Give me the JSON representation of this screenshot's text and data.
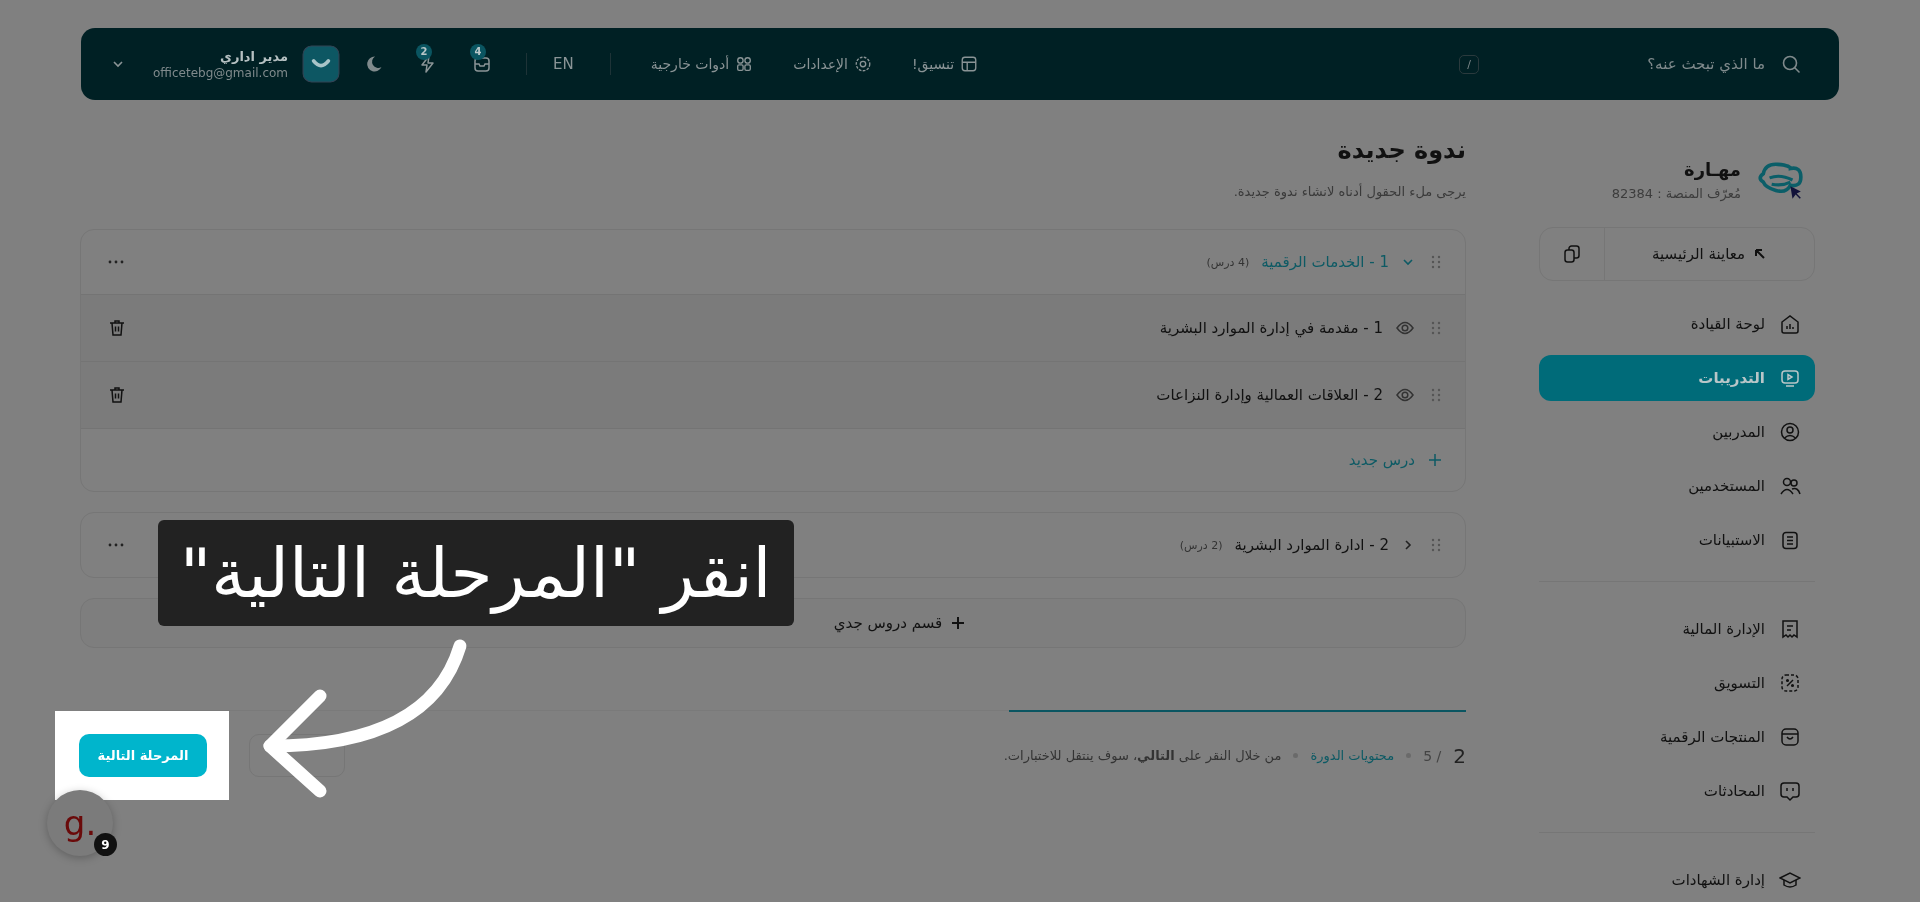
{
  "topbar": {
    "search": {
      "placeholder": "ما الذي تبحث عنه؟",
      "shortcut": "/"
    },
    "links": [
      "تنسيق!",
      "الإعدادات",
      "أدوات خارجية"
    ],
    "language": "EN",
    "notifications": [
      {
        "count": "4"
      },
      {
        "count": "2"
      }
    ],
    "user": {
      "name": "مدير اداري",
      "email": "officetebg@gmail.com"
    }
  },
  "sidebar": {
    "brand": {
      "name": "مهـارة",
      "platform_id": "مُعرّف المنصة : 82384"
    },
    "preview": "معاينة الرئيسية",
    "groups": [
      [
        {
          "label": "لوحة القيادة",
          "selected": false
        },
        {
          "label": "التدريبات",
          "selected": true
        },
        {
          "label": "المدربين",
          "selected": false
        },
        {
          "label": "المستخدمين",
          "selected": false
        },
        {
          "label": "الاستبيانات",
          "selected": false
        }
      ],
      [
        {
          "label": "الإدارة المالية",
          "selected": false
        },
        {
          "label": "التسويق",
          "selected": false
        },
        {
          "label": "المنتجات الرقمية",
          "selected": false
        },
        {
          "label": "المحادثات",
          "selected": false
        }
      ],
      [
        {
          "label": "إدارة الشهادات",
          "selected": false
        }
      ]
    ]
  },
  "page": {
    "title": "ندوة جديدة",
    "subtitle": "يرجى ملء الحقول أدناه لانشاء ندوة جديدة."
  },
  "sections": [
    {
      "title": "1 - الخدمات الرقمية",
      "count": "(4 درس)",
      "expanded": true,
      "lessons": [
        "1 - مقدمة في إدارة الموارد البشرية",
        "2 - العلاقات العمالية وإدارة النزاعات"
      ],
      "add_lesson": "درس جديد"
    },
    {
      "title": "2 - ادارة الموارد البشرية",
      "count": "(2 درس)",
      "expanded": false
    }
  ],
  "add_section": "قسم دروس جدي",
  "footer": {
    "progress": {
      "level": 0.33
    },
    "step": "2",
    "total": "/ 5",
    "link": "محتويات الدورة",
    "hint": "من خلال النقر على **التالي**، سوف ينتقل للاختبارات.",
    "next_button": "المرحلة التالية"
  },
  "tour": {
    "callout": "انقر \"المرحلة التالية\"",
    "help_logo": "g.",
    "help_badge": "9"
  }
}
